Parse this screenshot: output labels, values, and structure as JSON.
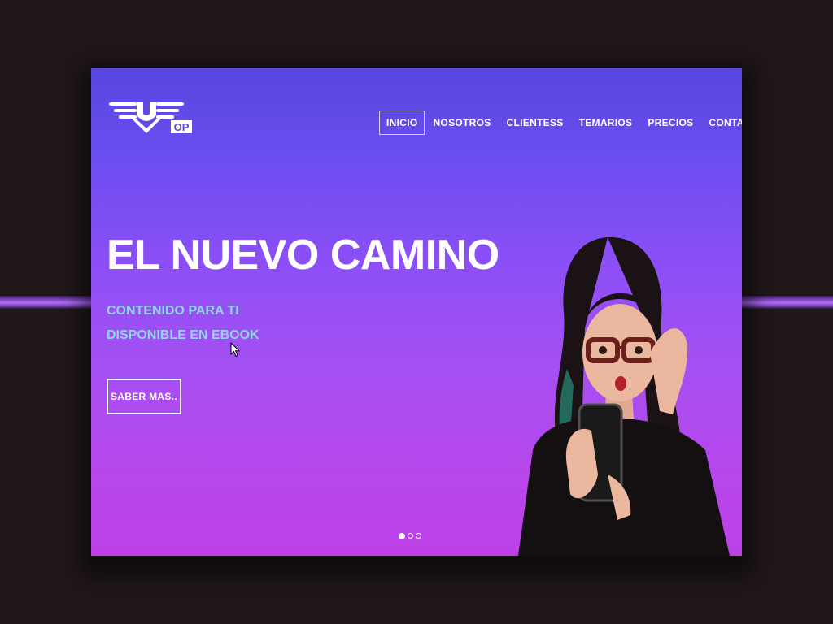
{
  "nav": {
    "items": [
      {
        "label": "INICIO",
        "active": true
      },
      {
        "label": "NOSOTROS",
        "active": false
      },
      {
        "label": "CLIENTESS",
        "active": false
      },
      {
        "label": "TEMARIOS",
        "active": false
      },
      {
        "label": "PRECIOS",
        "active": false
      },
      {
        "label": "CONTACTO",
        "active": false
      }
    ]
  },
  "logo": {
    "text": "OP",
    "icon": "winged-emblem-logo"
  },
  "hero": {
    "title": "EL NUEVO CAMINO",
    "subtitle_line1": "CONTENIDO PARA TI",
    "subtitle_line2": "DISPONIBLE EN EBOOK",
    "cta_label": "SABER MAS.."
  },
  "carousel": {
    "slide_count": 3,
    "active_index": 0
  },
  "colors": {
    "gradient_top": "#5846de",
    "gradient_bottom": "#bd40e6",
    "subtitle": "#8fd6ea",
    "text": "#ffffff",
    "backdrop": "#201718"
  }
}
